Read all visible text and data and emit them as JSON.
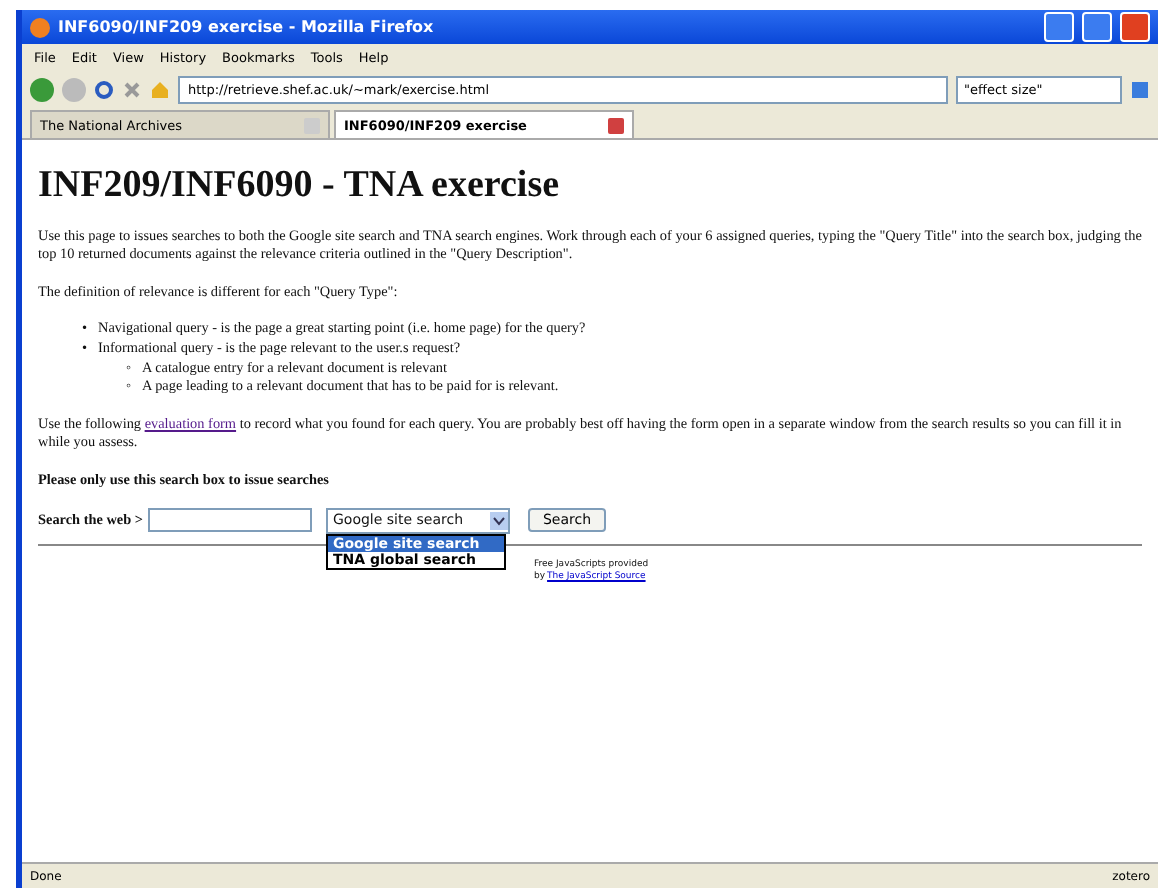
{
  "window": {
    "title": "INF6090/INF209 exercise - Mozilla Firefox"
  },
  "menu": [
    "File",
    "Edit",
    "View",
    "History",
    "Bookmarks",
    "Tools",
    "Help"
  ],
  "address": {
    "value": "http://retrieve.shef.ac.uk/~mark/exercise.html"
  },
  "search": {
    "value": "\"effect size\""
  },
  "tabs": [
    {
      "label": "The National Archives",
      "selected": false
    },
    {
      "label": "INF6090/INF209 exercise",
      "selected": true
    }
  ],
  "page": {
    "heading": "INF209/INF6090 - TNA exercise",
    "intro": "Use this page to issues searches to both the Google site search and TNA search engines. Work through each of your 6 assigned queries, typing the \"Query Title\" into the search box, judging the top 10 returned documents against the relevance criteria outlined in the \"Query Description\".",
    "definition": "The definition of relevance is different for each \"Query Type\":",
    "list": [
      {
        "marker": "•",
        "text": "Navigational query - is the page a great starting point (i.e. home page) for the query?"
      },
      {
        "marker": "•",
        "text": "Informational query - is the page relevant to the user.s request?",
        "children": [
          {
            "marker": "◦",
            "text": "A catalogue entry for a relevant document is relevant"
          },
          {
            "marker": "◦",
            "text": "A page leading to a relevant document that has to be paid for is relevant."
          }
        ]
      }
    ],
    "usage_before": "Use the following ",
    "usage_link": "evaluation form",
    "usage_after": " to record what you found for each query. You are probably best off having the form open in a separate window from the search results so you can fill it in while you assess.",
    "note": "Please only use this search box to issue searches",
    "search_label": "Search the web >",
    "engine": {
      "value": "Google site search",
      "options": [
        {
          "label": "Google site search",
          "selected": true
        },
        {
          "label": "TNA global search",
          "selected": false
        }
      ]
    },
    "search_button": "Search",
    "credit": "Free JavaScripts provided",
    "credit_by": "by ",
    "credit_link": "The JavaScript Source"
  },
  "status_bar": {
    "text": "Done",
    "addon": "zotero"
  }
}
